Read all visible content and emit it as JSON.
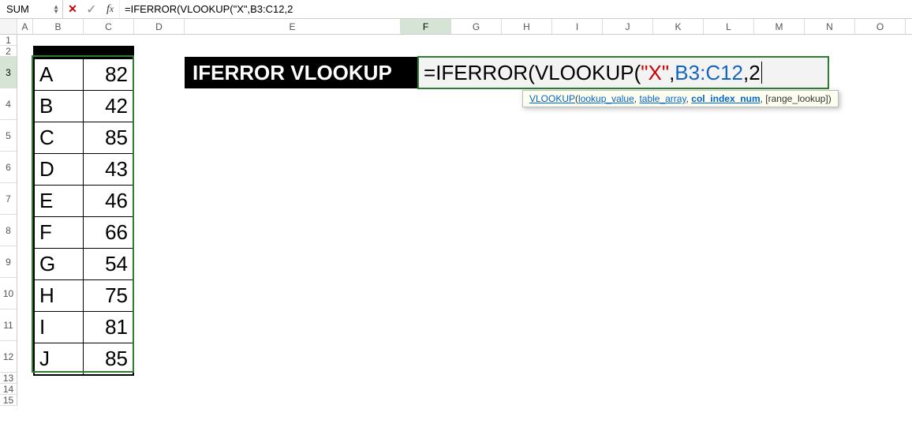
{
  "name_box": "SUM",
  "formula_bar_text": "=IFERROR(VLOOKUP(\"X\",B3:C12,2",
  "columns": [
    "A",
    "B",
    "C",
    "D",
    "E",
    "F",
    "G",
    "H",
    "I",
    "J",
    "K",
    "L",
    "M",
    "N",
    "O"
  ],
  "active_column_index": 5,
  "rows": [
    1,
    2,
    3,
    4,
    5,
    6,
    7,
    8,
    9,
    10,
    11,
    12,
    13,
    14,
    15
  ],
  "active_row_index": 2,
  "data_table": [
    {
      "key": "A",
      "val": "82"
    },
    {
      "key": "B",
      "val": "42"
    },
    {
      "key": "C",
      "val": "85"
    },
    {
      "key": "D",
      "val": "43"
    },
    {
      "key": "E",
      "val": "46"
    },
    {
      "key": "F",
      "val": "66"
    },
    {
      "key": "G",
      "val": "54"
    },
    {
      "key": "H",
      "val": "75"
    },
    {
      "key": "I",
      "val": "81"
    },
    {
      "key": "J",
      "val": "85"
    }
  ],
  "label_cell": "IFERROR VLOOKUP",
  "formula_cell_parts": {
    "eq": "=",
    "fn1": "IFERROR",
    "op1": "(",
    "fn2": "VLOOKUP",
    "op2": "(",
    "str": "\"X\"",
    "c1": ",",
    "ref": "B3:C12",
    "c2": ",",
    "num": "2"
  },
  "tooltip": {
    "fn": "VLOOKUP",
    "open": "(",
    "arg1": "lookup_value",
    "sep1": ", ",
    "arg2": "table_array",
    "sep2": ", ",
    "arg3": "col_index_num",
    "sep3": ", ",
    "arg4": "[range_lookup]",
    "close": ")"
  }
}
